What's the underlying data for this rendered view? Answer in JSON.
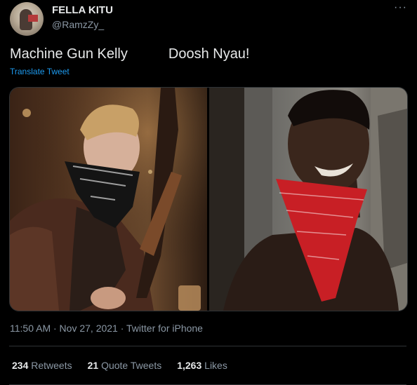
{
  "author": {
    "name": "FELLA KITU",
    "handle": "@RamzZy_",
    "avatar_icon": "profile-avatar"
  },
  "more_icon": "more-icon",
  "tweet": {
    "text_left": "Machine Gun Kelly",
    "text_right": "Doosh Nyau!",
    "translate_label": "Translate Tweet"
  },
  "media": {
    "images": [
      {
        "icon": "photo-machine-gun-kelly"
      },
      {
        "icon": "photo-doosh-nyau"
      }
    ]
  },
  "meta": {
    "timestamp": "11:50 AM · Nov 27, 2021 · Twitter for iPhone"
  },
  "stats": {
    "retweets_count": "234",
    "retweets_label": "Retweets",
    "quotes_count": "21",
    "quotes_label": "Quote Tweets",
    "likes_count": "1,263",
    "likes_label": "Likes"
  },
  "colors": {
    "background": "#000000",
    "text": "#e7e9ea",
    "muted": "#8b98a5",
    "link": "#1d9bf0",
    "border": "#2f3336"
  }
}
